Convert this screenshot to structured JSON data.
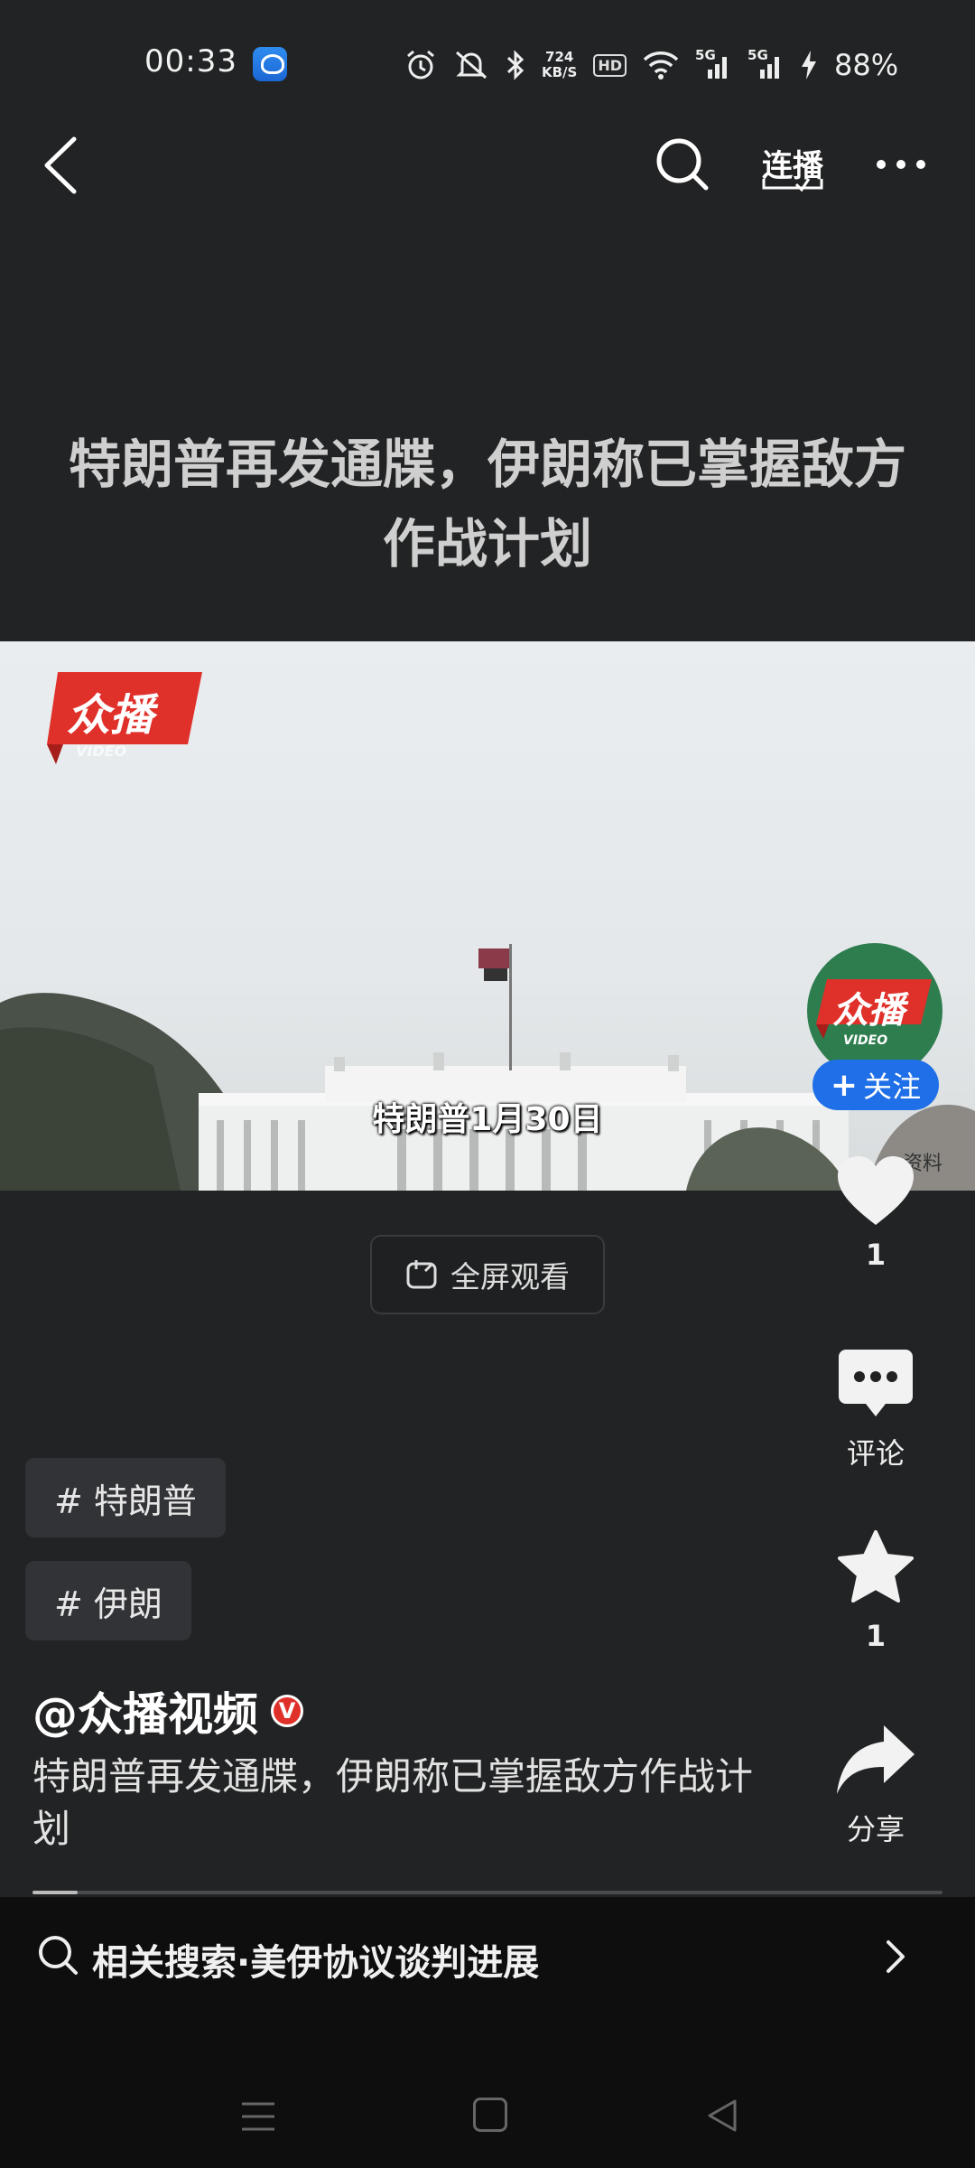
{
  "status_bar": {
    "time": "00:33",
    "speed_value": "724",
    "speed_unit": "KB/S",
    "hd_label": "HD",
    "net1": "5G",
    "net2": "5G",
    "battery": "88%",
    "icons": [
      "app-icon",
      "alarm-icon",
      "mute-icon",
      "bluetooth-icon",
      "wifi-icon",
      "signal-icon",
      "signal-icon",
      "charging-icon"
    ]
  },
  "nav": {
    "lianbo_label": "连播"
  },
  "video": {
    "title": "特朗普再发通牒，伊朗称已掌握敌方作战计划",
    "logo_text": "众播",
    "logo_sub": "VIDEO",
    "subtitle": "特朗普1月30日",
    "watermark": "资料",
    "fullscreen_label": "全屏观看"
  },
  "actions": {
    "avatar_logo": "众播",
    "avatar_sub": "VIDEO",
    "follow_label": "关注",
    "like_count": "1",
    "comment_label": "评论",
    "favorite_count": "1",
    "share_label": "分享"
  },
  "hashtags": [
    "# 特朗普",
    "# 伊朗"
  ],
  "author": "@众播视频",
  "verified_mark": "V",
  "description": "特朗普再发通牒，伊朗称已掌握敌方作战计划",
  "progress": 0.05,
  "related_search": "相关搜索·美伊协议谈判进展",
  "colors": {
    "background": "#222324",
    "follow_blue": "#1f6fe8",
    "logo_red": "#e0302a",
    "avatar_green": "#2e7d4f"
  }
}
